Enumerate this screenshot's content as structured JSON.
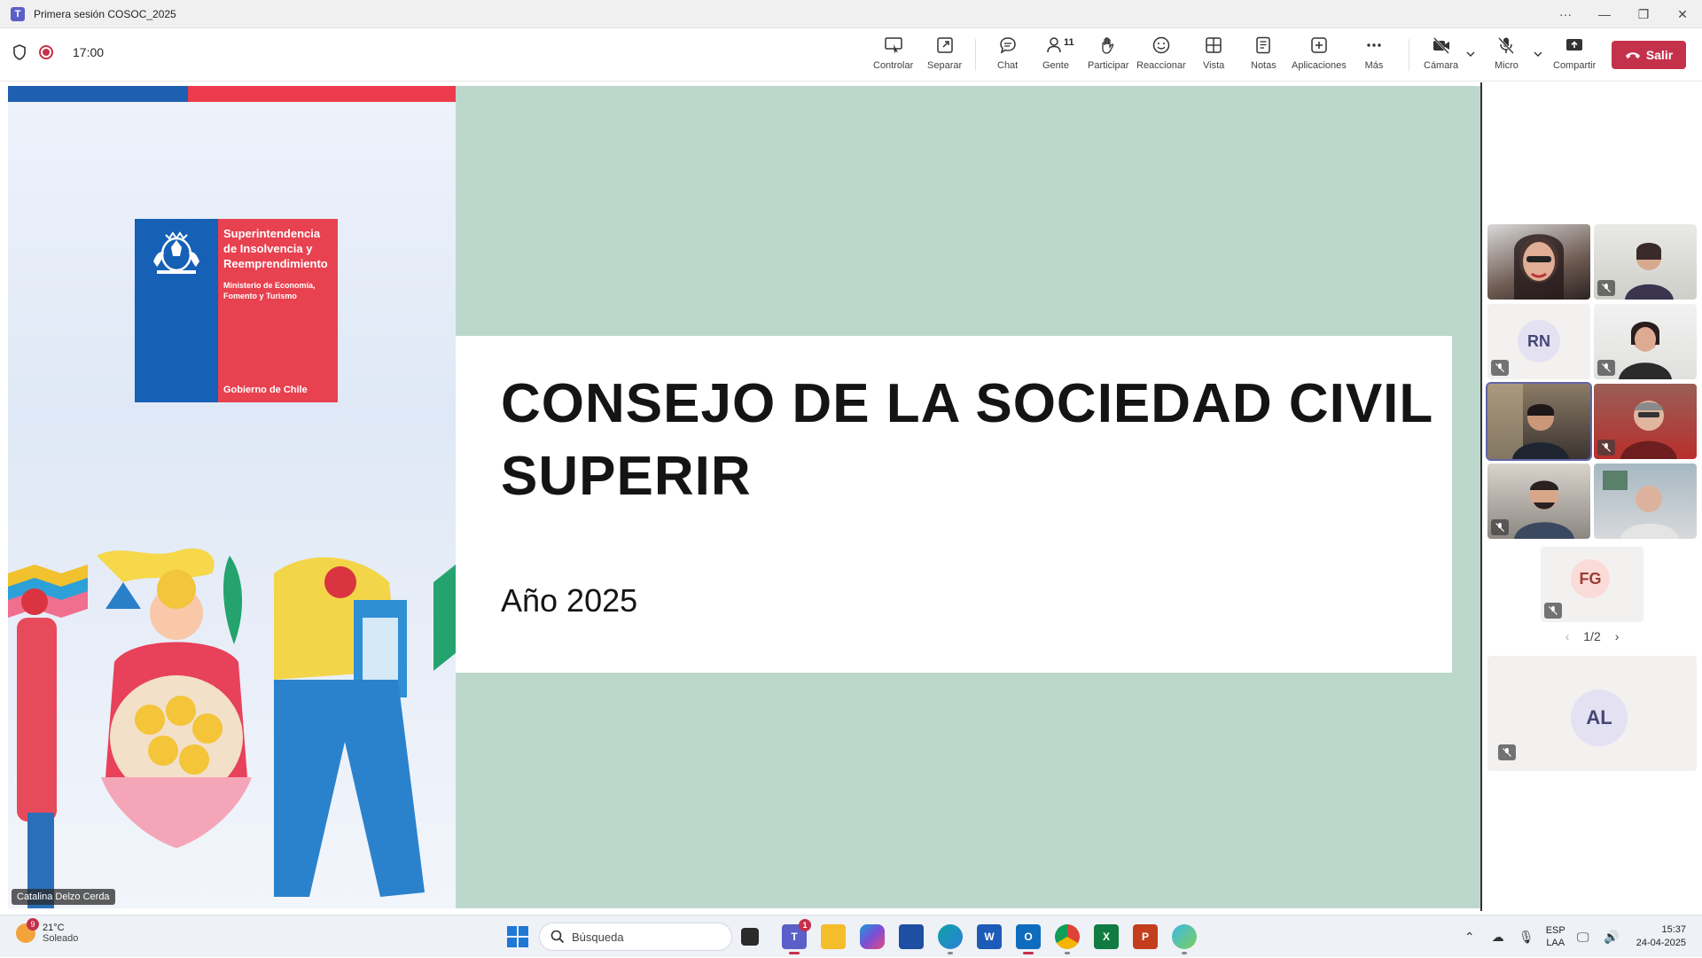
{
  "window": {
    "title": "Primera sesión COSOC_2025"
  },
  "meeting": {
    "timer": "17:00"
  },
  "toolbar": {
    "controlar": "Controlar",
    "separar": "Separar",
    "chat": "Chat",
    "gente": "Gente",
    "gente_count": "11",
    "participar": "Participar",
    "reaccionar": "Reaccionar",
    "vista": "Vista",
    "notas": "Notas",
    "aplicaciones": "Aplicaciones",
    "mas": "Más",
    "camara": "Cámara",
    "micro": "Micro",
    "compartir": "Compartir",
    "salir": "Salir"
  },
  "slide": {
    "title": "CONSEJO DE LA SOCIEDAD CIVIL SUPERIR",
    "subtitle": "Año 2025",
    "logo": {
      "org": "Superintendencia de Insolvencia y Reemprendimiento",
      "ministry": "Ministerio de Economía, Fomento y Turismo",
      "gov": "Gobierno de Chile"
    },
    "presenter": "Catalina Delzo Cerda"
  },
  "participants": {
    "initials": [
      "RN",
      "FG",
      "AL"
    ],
    "page": "1/2"
  },
  "taskbar": {
    "weather_temp": "21°C",
    "weather_desc": "Soleado",
    "weather_badge": "9",
    "search_placeholder": "Búsqueda",
    "teams_badge": "1",
    "lang_1": "ESP",
    "lang_2": "LAA",
    "time": "15:37",
    "date": "24-04-2025"
  },
  "colors": {
    "leave": "#c4314b",
    "slide_bg": "#bcd8cc",
    "accent": "#6264a7"
  }
}
